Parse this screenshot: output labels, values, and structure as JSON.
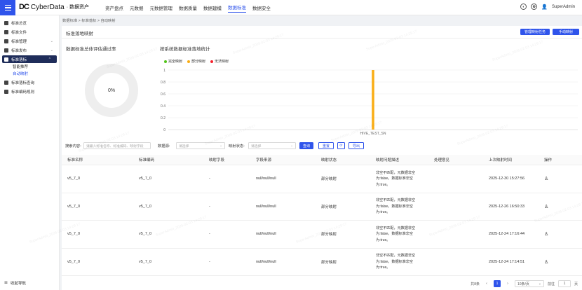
{
  "app": {
    "logo_mark": "DC",
    "name": "CyberData",
    "sub": "· 数据资产"
  },
  "topnav": [
    "资产盘点",
    "元数据",
    "元数据管理",
    "数据质量",
    "数据建模",
    "数据标准",
    "数据安全"
  ],
  "topnav_active_index": 5,
  "user": {
    "name": "SuperAdmin"
  },
  "sidebar": {
    "items": [
      {
        "label": "标准总览"
      },
      {
        "label": "标准文件"
      },
      {
        "label": "标准管理"
      },
      {
        "label": "标准发布"
      },
      {
        "label": "标准落标"
      }
    ],
    "subitems": [
      {
        "label": "智能推荐"
      },
      {
        "label": "自动映射"
      }
    ],
    "items2": [
      {
        "label": "标准落标查询"
      },
      {
        "label": "标准编码规则"
      }
    ],
    "footer": "收起导航"
  },
  "breadcrumb": "数据标准 > 标准落标 > 自动映射",
  "page": {
    "title": "标准落地映射",
    "btn_manage": "管理映射任务",
    "btn_manual": "手动映射"
  },
  "donut": {
    "title": "数据标准总体评估通过率",
    "value": "0%"
  },
  "chart_data": {
    "type": "bar",
    "title": "按系统数据标准落地统计",
    "categories": [
      "HIVE_TEST_SN"
    ],
    "series": [
      {
        "name": "完全映射",
        "color": "#52c41a",
        "values": [
          0
        ]
      },
      {
        "name": "部分映射",
        "color": "#faad14",
        "values": [
          1
        ]
      },
      {
        "name": "无法映射",
        "color": "#f5222d",
        "values": [
          0
        ]
      }
    ],
    "ylim": [
      0,
      1
    ],
    "yticks": [
      "1",
      "0.8",
      "0.6",
      "0.4",
      "0.2",
      "0"
    ]
  },
  "filter": {
    "content_label": "搜索内容:",
    "content_placeholder": "请输入标准名称、标准编码、映射字段",
    "source_label": "数据源:",
    "source_placeholder": "请选择",
    "status_label": "映射状态:",
    "status_placeholder": "请选择",
    "query": "查询",
    "reset": "重置",
    "export": "导出"
  },
  "table": {
    "headers": [
      "标准名称",
      "标准编码",
      "映射字段",
      "字段来源",
      "映射状态",
      "映射问题描述",
      "处理意见",
      "上次映射时间",
      "操作"
    ],
    "rows": [
      {
        "name": "v5_7_0",
        "code": "v5_7_0",
        "field": "-",
        "source": "null/null/null",
        "status": "部分映射",
        "desc1": "非空不匹配，元数据非空",
        "desc2": "为:false，数据标准非空",
        "desc3": "为:true。",
        "opinion": "",
        "time": "2025-12-30 15:27:56"
      },
      {
        "name": "v5_7_0",
        "code": "v5_7_0",
        "field": "-",
        "source": "null/null/null",
        "status": "部分映射",
        "desc1": "非空不匹配，元数据非空",
        "desc2": "为:false，数据标准非空",
        "desc3": "为:true。",
        "opinion": "",
        "time": "2025-12-26 16:50:33"
      },
      {
        "name": "v5_7_0",
        "code": "v5_7_0",
        "field": "-",
        "source": "null/null/null",
        "status": "部分映射",
        "desc1": "非空不匹配，元数据非空",
        "desc2": "为:false，数据标准非空",
        "desc3": "为:true。",
        "opinion": "",
        "time": "2025-12-24 17:16:44"
      },
      {
        "name": "v5_7_0",
        "code": "v5_7_0",
        "field": "-",
        "source": "null/null/null",
        "status": "部分映射",
        "desc1": "非空不匹配，元数据非空",
        "desc2": "为:false，数据标准非空",
        "desc3": "为:true。",
        "opinion": "",
        "time": "2025-12-24 17:14:51"
      }
    ]
  },
  "pager": {
    "total": "共8条",
    "current": "1",
    "size": "10条/页",
    "goto": "前往",
    "goto_value": "1",
    "page_unit": "页"
  },
  "watermark": "SuperAdmin_2026-02-03 14:29:17"
}
